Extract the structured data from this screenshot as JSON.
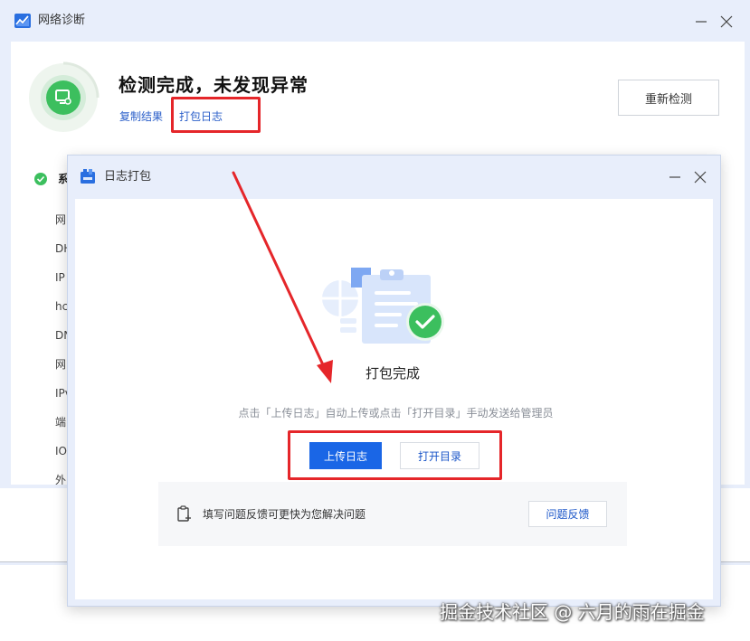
{
  "main_window": {
    "title": "网络诊断",
    "result_title": "检测完成，未发现异常",
    "copy_result_label": "复制结果",
    "pack_log_label": "打包日志",
    "redetect_label": "重新检测",
    "section_label": "系",
    "background_items": [
      "网",
      "DH",
      "IP",
      "hc",
      "DN",
      "网",
      "IPv",
      "端",
      "IO",
      "外"
    ]
  },
  "dialog": {
    "title": "日志打包",
    "status_text": "打包完成",
    "instruction_text": "点击「上传日志」自动上传或点击「打开目录」手动发送给管理员",
    "upload_label": "上传日志",
    "open_dir_label": "打开目录",
    "feedback_text": "填写问题反馈可更快为您解决问题",
    "feedback_button_label": "问题反馈"
  },
  "watermark": "掘金技术社区 @ 六月的雨在掘金",
  "colors": {
    "accent_blue": "#1a66e6",
    "link_blue": "#2b5fc9",
    "success_green": "#3cbf5e",
    "annotation_red": "#e5262a",
    "titlebar_bg": "#e8eefb"
  }
}
